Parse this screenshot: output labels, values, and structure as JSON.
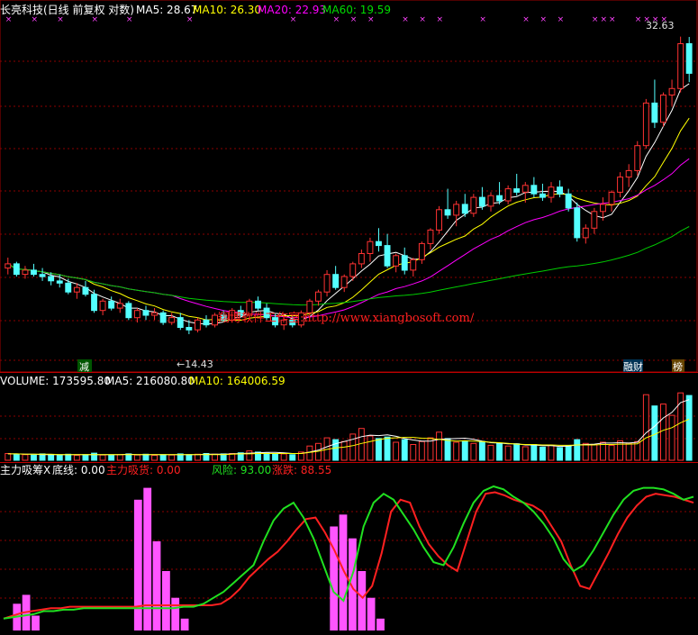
{
  "header": {
    "title": "长亮科技(日线 前复权 对数)",
    "ma5": "MA5: 28.67",
    "ma10": "MA10: 26.30",
    "ma20": "MA20: 22.93",
    "ma60": "MA60: 19.59"
  },
  "volume_header": {
    "volume": "VOLUME: 173595.80",
    "ma5": "MA5: 216080.80",
    "ma10": "MA10: 164006.59"
  },
  "indicator_header": {
    "name": "主力吸筹X",
    "bottom": "底线: 0.00",
    "main_absorb": "主力吸货: 0.00",
    "risk": "风险: 93.00",
    "change": "涨跌: 88.55"
  },
  "annotations": {
    "high_price": "32.63",
    "low_price": "←14.43",
    "watermark": "翔博软件工作室:http://www.xiangbosoft.com/",
    "tag_reduce": "减",
    "tag_finance": "融财",
    "tag_list": "榜"
  },
  "colors": {
    "up": "#ff3232",
    "down": "#54ffff",
    "ma5": "#ffffff",
    "ma10": "#ffff00",
    "ma20": "#ff00ff",
    "ma60": "#00cc00",
    "grid": "#8b0000",
    "risk_line": "#ff2020",
    "change_line": "#20e020",
    "absorb_bar": "#ff55ff"
  },
  "chart_data": [
    {
      "type": "candlestick",
      "title": "长亮科技(日线 前复权 对数)",
      "ylim": [
        13.5,
        33.5
      ],
      "log_scale": true,
      "grid": true,
      "candles_ohlc": [
        [
          17.3,
          17.8,
          17.0,
          17.5
        ],
        [
          17.5,
          17.6,
          16.9,
          17.0
        ],
        [
          17.0,
          17.4,
          16.8,
          17.2
        ],
        [
          17.2,
          17.5,
          16.9,
          17.0
        ],
        [
          17.0,
          17.3,
          16.7,
          16.9
        ],
        [
          16.9,
          17.1,
          16.5,
          16.7
        ],
        [
          16.7,
          17.0,
          16.4,
          16.6
        ],
        [
          16.6,
          16.8,
          16.1,
          16.2
        ],
        [
          16.2,
          16.6,
          15.9,
          16.4
        ],
        [
          16.4,
          16.7,
          16.0,
          16.1
        ],
        [
          16.1,
          16.3,
          15.3,
          15.4
        ],
        [
          15.4,
          15.9,
          15.2,
          15.8
        ],
        [
          15.8,
          16.0,
          15.4,
          15.5
        ],
        [
          15.5,
          15.9,
          15.3,
          15.7
        ],
        [
          15.7,
          15.8,
          15.0,
          15.1
        ],
        [
          15.1,
          15.5,
          14.9,
          15.4
        ],
        [
          15.4,
          15.6,
          15.0,
          15.2
        ],
        [
          15.2,
          15.5,
          15.0,
          15.3
        ],
        [
          15.3,
          15.4,
          14.8,
          14.9
        ],
        [
          14.9,
          15.3,
          14.8,
          15.1
        ],
        [
          15.1,
          15.3,
          14.6,
          14.7
        ],
        [
          14.7,
          15.0,
          14.43,
          14.6
        ],
        [
          14.6,
          15.1,
          14.5,
          15.0
        ],
        [
          15.0,
          15.2,
          14.7,
          14.8
        ],
        [
          14.8,
          15.3,
          14.7,
          15.2
        ],
        [
          15.2,
          15.4,
          14.9,
          15.0
        ],
        [
          15.0,
          15.5,
          14.9,
          15.4
        ],
        [
          15.4,
          15.6,
          15.1,
          15.2
        ],
        [
          15.2,
          15.9,
          15.1,
          15.8
        ],
        [
          15.8,
          16.0,
          15.4,
          15.5
        ],
        [
          15.5,
          15.7,
          15.0,
          15.1
        ],
        [
          15.1,
          15.3,
          14.7,
          14.8
        ],
        [
          14.8,
          15.1,
          14.6,
          15.0
        ],
        [
          15.0,
          15.2,
          14.7,
          14.8
        ],
        [
          14.8,
          15.4,
          14.7,
          15.3
        ],
        [
          15.3,
          15.9,
          15.2,
          15.8
        ],
        [
          15.8,
          16.3,
          15.6,
          16.2
        ],
        [
          16.2,
          17.2,
          16.0,
          17.0
        ],
        [
          17.0,
          17.4,
          16.3,
          16.4
        ],
        [
          16.4,
          17.0,
          16.2,
          16.9
        ],
        [
          16.9,
          17.6,
          16.7,
          17.5
        ],
        [
          17.5,
          18.2,
          17.3,
          18.0
        ],
        [
          18.0,
          18.8,
          17.6,
          18.6
        ],
        [
          18.6,
          19.3,
          18.1,
          18.4
        ],
        [
          18.4,
          19.0,
          17.3,
          17.4
        ],
        [
          17.4,
          18.0,
          17.1,
          17.9
        ],
        [
          17.9,
          18.3,
          17.0,
          17.2
        ],
        [
          17.2,
          17.8,
          16.9,
          17.7
        ],
        [
          17.7,
          18.6,
          17.5,
          18.5
        ],
        [
          18.5,
          19.3,
          18.2,
          19.2
        ],
        [
          19.2,
          20.5,
          19.0,
          20.3
        ],
        [
          20.3,
          21.5,
          19.8,
          20.0
        ],
        [
          20.0,
          20.8,
          19.4,
          20.6
        ],
        [
          20.6,
          21.2,
          19.9,
          20.1
        ],
        [
          20.1,
          21.2,
          19.9,
          21.0
        ],
        [
          21.0,
          21.6,
          20.3,
          20.5
        ],
        [
          20.5,
          21.3,
          20.2,
          21.1
        ],
        [
          21.1,
          21.9,
          20.6,
          20.8
        ],
        [
          20.8,
          21.7,
          20.6,
          21.5
        ],
        [
          21.5,
          22.4,
          21.1,
          21.3
        ],
        [
          21.3,
          21.9,
          20.7,
          21.7
        ],
        [
          21.7,
          22.2,
          21.0,
          21.2
        ],
        [
          21.2,
          21.8,
          20.8,
          21.0
        ],
        [
          21.0,
          21.9,
          20.7,
          21.6
        ],
        [
          21.6,
          22.0,
          21.0,
          21.2
        ],
        [
          21.2,
          21.5,
          20.2,
          20.4
        ],
        [
          20.4,
          20.7,
          18.6,
          18.8
        ],
        [
          18.8,
          19.5,
          18.5,
          19.3
        ],
        [
          19.3,
          20.4,
          19.0,
          20.2
        ],
        [
          20.2,
          21.0,
          19.7,
          20.6
        ],
        [
          20.6,
          21.4,
          20.2,
          21.3
        ],
        [
          21.3,
          22.5,
          21.0,
          22.2
        ],
        [
          22.2,
          23.0,
          21.6,
          22.6
        ],
        [
          22.6,
          24.5,
          22.3,
          24.2
        ],
        [
          24.2,
          27.5,
          24.0,
          27.2
        ],
        [
          27.2,
          29.0,
          25.4,
          25.8
        ],
        [
          25.8,
          28.0,
          25.5,
          27.8
        ],
        [
          27.8,
          29.0,
          27.0,
          28.3
        ],
        [
          28.3,
          32.63,
          28.0,
          32.0
        ],
        [
          32.0,
          32.6,
          28.8,
          29.5
        ]
      ]
    },
    {
      "type": "bar",
      "title": "VOLUME",
      "series": [
        {
          "name": "VOLUME",
          "values": [
            18,
            16,
            15,
            14,
            17,
            15,
            14,
            16,
            13,
            15,
            19,
            14,
            13,
            15,
            17,
            14,
            16,
            13,
            15,
            14,
            17,
            15,
            16,
            18,
            16,
            17,
            18,
            20,
            25,
            22,
            19,
            16,
            17,
            15,
            22,
            38,
            45,
            60,
            55,
            50,
            70,
            85,
            65,
            58,
            62,
            48,
            55,
            42,
            50,
            60,
            75,
            58,
            48,
            52,
            45,
            50,
            40,
            46,
            38,
            44,
            36,
            42,
            35,
            40,
            34,
            38,
            55,
            45,
            42,
            48,
            40,
            52,
            46,
            50,
            175,
            145,
            150,
            120,
            180,
            173
          ]
        },
        {
          "name": "MA5",
          "values": [
            17,
            17,
            16,
            16,
            15,
            15,
            15,
            15,
            15,
            15,
            15,
            15,
            15,
            15,
            16,
            15,
            15,
            15,
            15,
            15,
            15,
            15,
            15,
            16,
            16,
            16,
            17,
            18,
            19,
            20,
            21,
            21,
            20,
            18,
            18,
            22,
            27,
            36,
            44,
            50,
            56,
            63,
            67,
            66,
            68,
            64,
            58,
            54,
            51,
            51,
            56,
            57,
            58,
            59,
            56,
            51,
            47,
            46,
            44,
            44,
            41,
            41,
            39,
            39,
            37,
            38,
            41,
            42,
            43,
            46,
            46,
            47,
            46,
            48,
            73,
            91,
            113,
            128,
            154,
            162
          ]
        },
        {
          "name": "MA10",
          "values": [
            17,
            17,
            16,
            16,
            16,
            16,
            15,
            15,
            15,
            15,
            15,
            15,
            15,
            15,
            15,
            15,
            15,
            15,
            15,
            15,
            15,
            15,
            15,
            15,
            15,
            15,
            16,
            17,
            17,
            18,
            18,
            18,
            18,
            18,
            18,
            21,
            24,
            29,
            33,
            35,
            39,
            45,
            50,
            55,
            59,
            60,
            61,
            61,
            59,
            58,
            56,
            53,
            51,
            52,
            51,
            50,
            48,
            47,
            45,
            43,
            42,
            42,
            41,
            41,
            40,
            40,
            41,
            41,
            41,
            42,
            42,
            43,
            43,
            44,
            60,
            69,
            80,
            87,
            100,
            110
          ]
        }
      ]
    },
    {
      "type": "line",
      "title": "主力吸筹X",
      "ylim": [
        0,
        100
      ],
      "series": [
        {
          "name": "风险",
          "values": [
            8,
            10,
            12,
            13,
            14,
            15,
            15,
            16,
            16,
            16,
            16,
            16,
            16,
            16,
            16,
            17,
            17,
            17,
            17,
            17,
            17,
            17,
            17,
            18,
            22,
            28,
            36,
            42,
            48,
            53,
            60,
            68,
            75,
            76,
            66,
            54,
            40,
            28,
            22,
            30,
            52,
            80,
            88,
            86,
            70,
            58,
            50,
            44,
            40,
            60,
            80,
            92,
            93,
            91,
            88,
            86,
            84,
            80,
            70,
            60,
            44,
            30,
            28,
            40,
            52,
            65,
            76,
            84,
            90,
            92,
            91,
            90,
            88,
            86
          ]
        },
        {
          "name": "涨跌",
          "values": [
            8,
            9,
            10,
            11,
            13,
            13,
            14,
            14,
            15,
            15,
            15,
            15,
            15,
            15,
            15,
            15,
            15,
            15,
            16,
            16,
            18,
            22,
            26,
            32,
            38,
            44,
            60,
            74,
            82,
            86,
            76,
            62,
            44,
            26,
            20,
            40,
            70,
            86,
            92,
            88,
            78,
            68,
            56,
            46,
            44,
            56,
            72,
            86,
            94,
            97,
            95,
            90,
            86,
            80,
            72,
            62,
            48,
            40,
            44,
            54,
            66,
            78,
            88,
            94,
            96,
            96,
            95,
            92,
            88,
            90
          ]
        },
        {
          "name": "主力吸货",
          "values": [
            0,
            18,
            24,
            10,
            0,
            0,
            0,
            0,
            0,
            0,
            0,
            0,
            0,
            0,
            88,
            96,
            60,
            40,
            22,
            8,
            0,
            0,
            0,
            0,
            0,
            0,
            0,
            0,
            0,
            0,
            0,
            0,
            0,
            0,
            0,
            70,
            78,
            62,
            40,
            22,
            8,
            0,
            0,
            0,
            0,
            0,
            0,
            0,
            0,
            0,
            0,
            0,
            0,
            0,
            0,
            0,
            0,
            0,
            0,
            0,
            0,
            0,
            0,
            0,
            0,
            0,
            0,
            0,
            0,
            0,
            0,
            0,
            0,
            0
          ]
        }
      ]
    }
  ]
}
